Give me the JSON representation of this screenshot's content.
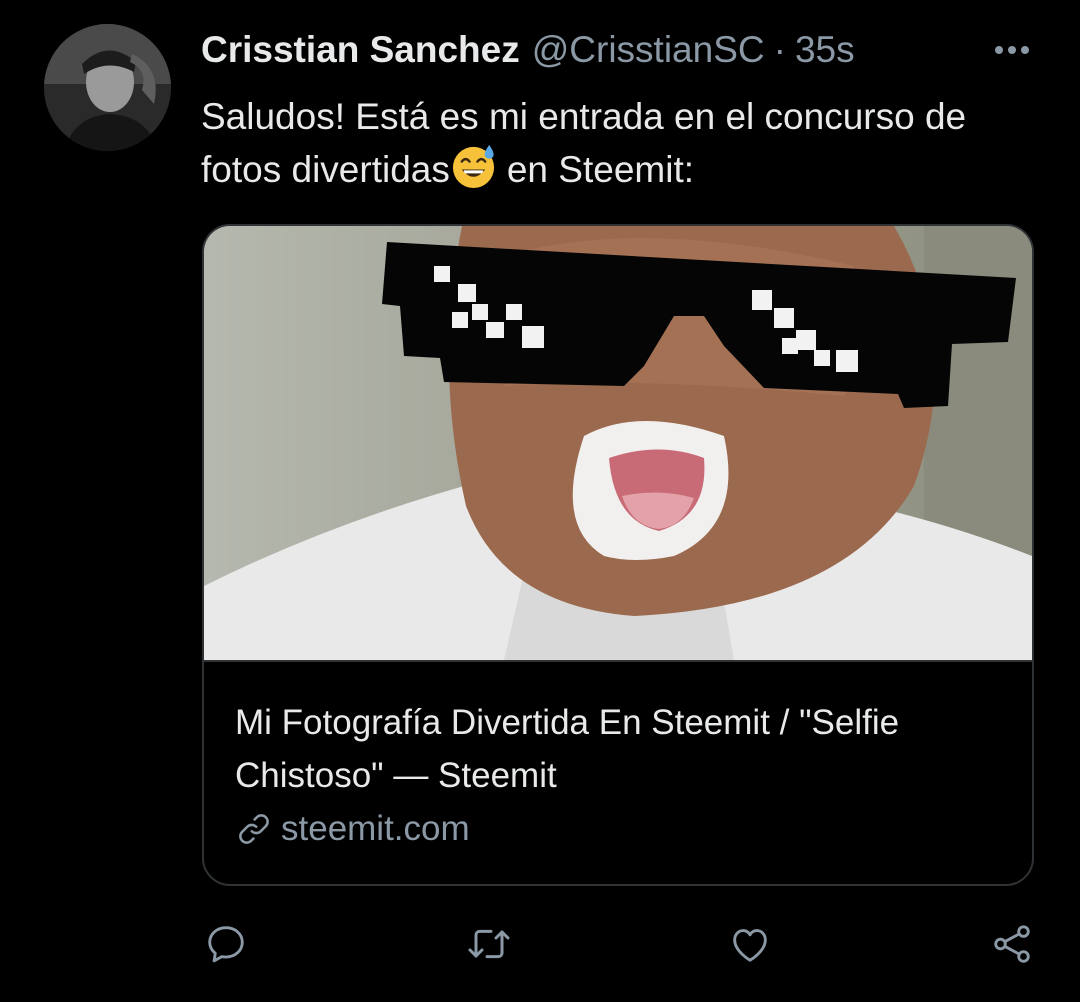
{
  "tweet": {
    "author": {
      "display_name": "Crisstian Sanchez",
      "handle": "@CrisstianSC",
      "separator": "·",
      "time": "35s"
    },
    "text_part1": "Saludos! Está es mi entrada en el concurso de fotos divertidas",
    "emoji": "grinning-face-with-sweat-emoji",
    "text_part2": "en Steemit:",
    "card": {
      "title": "Mi Fotografía Divertida En Steemit / \"Selfie Chistoso\" — Steemit",
      "domain": "steemit.com"
    },
    "actions": [
      "reply-icon",
      "retweet-icon",
      "like-icon",
      "share-icon"
    ]
  },
  "colors": {
    "background": "#000000",
    "text_primary": "#e7e9ea",
    "text_secondary": "#8b98a5",
    "border": "#2f3336"
  }
}
